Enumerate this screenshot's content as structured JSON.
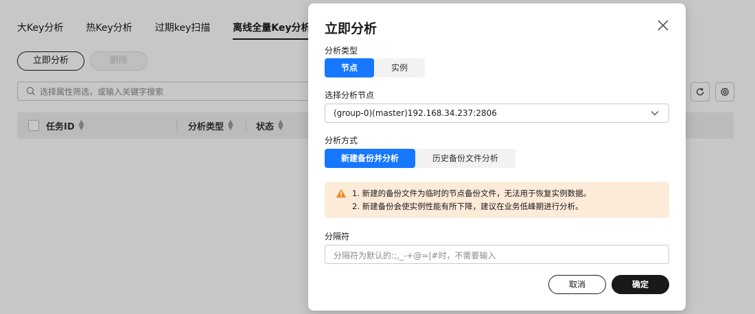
{
  "background": {
    "tabs": [
      "大Key分析",
      "热Key分析",
      "过期key扫描",
      "离线全量Key分析"
    ],
    "active_tab_index": 3,
    "analyze_button": "立即分析",
    "delete_button": "删除",
    "search_placeholder": "选择属性筛选，或输入关键字搜索",
    "columns": [
      "任务ID",
      "分析类型",
      "状态"
    ]
  },
  "modal": {
    "title": "立即分析",
    "analysis_type": {
      "label": "分析类型",
      "options": [
        "节点",
        "实例"
      ],
      "selected": "节点"
    },
    "node_select": {
      "label": "选择分析节点",
      "value": "(group-0)(master)192.168.34.237:2806"
    },
    "method": {
      "label": "分析方式",
      "options": [
        "新建备份并分析",
        "历史备份文件分析"
      ],
      "selected": "新建备份并分析"
    },
    "warning": {
      "lines": [
        "1. 新建的备份文件为临时的节点备份文件，无法用于恢复实例数据。",
        "2. 新建备份会使实例性能有所下降，建议在业务低峰期进行分析。"
      ]
    },
    "delimiter": {
      "label": "分隔符",
      "placeholder": "分隔符为默认的:;,_-+@=|#时，不需要输入"
    },
    "cancel_button": "取消",
    "confirm_button": "确定"
  },
  "colors": {
    "accent": "#1677ff",
    "warning_bg": "#fdebd9",
    "warning_icon": "#f08a24",
    "primary_button": "#191919"
  }
}
